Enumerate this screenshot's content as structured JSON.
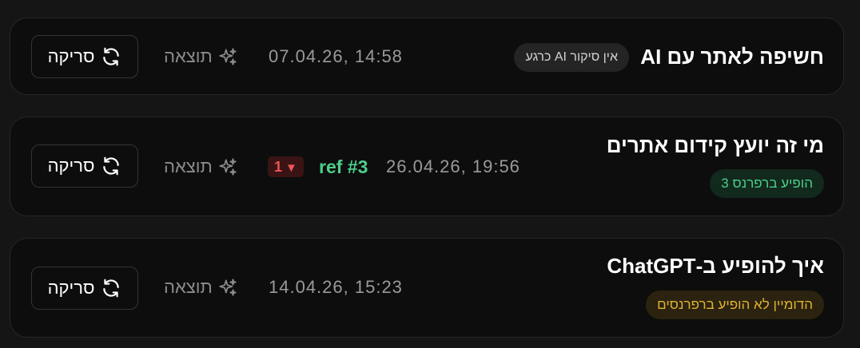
{
  "items": [
    {
      "title": "חשיפה לאתר עם AI",
      "badge": "אין סיקור AI כרגע",
      "date": "07.04.26, 14:58",
      "result_label": "תוצאה",
      "scan_label": "סריקה"
    },
    {
      "title": "מי זה יועץ קידום אתרים",
      "badge": "הופיע ברפרנס 3",
      "date": "26.04.26, 19:56",
      "ref": "ref #3",
      "rank_change": "1",
      "rank_direction": "down",
      "result_label": "תוצאה",
      "scan_label": "סריקה"
    },
    {
      "title": "איך להופיע ב-ChatGPT",
      "badge": "הדומיין לא הופיע ברפרנסים",
      "date": "14.04.26, 15:23",
      "result_label": "תוצאה",
      "scan_label": "סריקה"
    }
  ],
  "icons": {
    "result": "sparkles-icon",
    "scan": "refresh-icon",
    "rank": "triangle-down-icon"
  },
  "colors": {
    "success": "#4ccf8b",
    "warning": "#e1b331",
    "danger": "#ef5454",
    "neutral_badge": "#242424"
  }
}
